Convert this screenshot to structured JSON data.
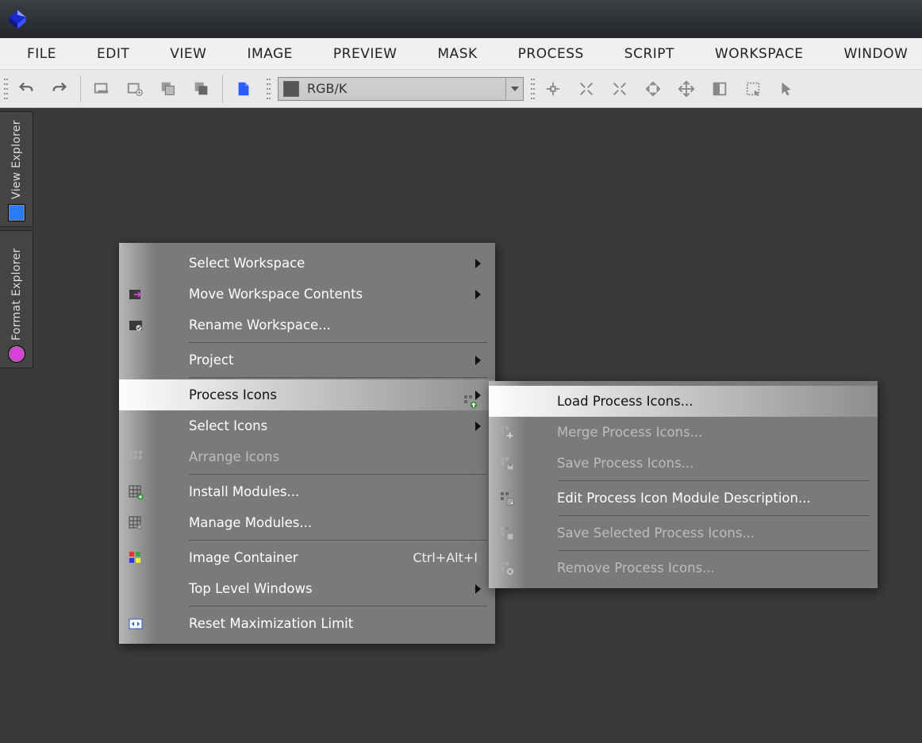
{
  "menubar": {
    "items": [
      "FILE",
      "EDIT",
      "VIEW",
      "IMAGE",
      "PREVIEW",
      "MASK",
      "PROCESS",
      "SCRIPT",
      "WORKSPACE",
      "WINDOW"
    ]
  },
  "toolbar": {
    "color_mode": "RGB/K"
  },
  "side_tabs": {
    "view": "View Explorer",
    "format": "Format Explorer"
  },
  "context_menu": {
    "main": {
      "select_workspace": "Select Workspace",
      "move_workspace_contents": "Move Workspace Contents",
      "rename_workspace": "Rename Workspace...",
      "project": "Project",
      "process_icons": "Process Icons",
      "select_icons": "Select Icons",
      "arrange_icons": "Arrange Icons",
      "install_modules": "Install Modules...",
      "manage_modules": "Manage Modules...",
      "image_container": "Image Container",
      "image_container_shortcut": "Ctrl+Alt+I",
      "top_level_windows": "Top Level Windows",
      "reset_max_limit": "Reset Maximization Limit"
    },
    "sub": {
      "load": "Load Process Icons...",
      "merge": "Merge Process Icons...",
      "save": "Save Process Icons...",
      "edit_desc": "Edit Process Icon Module Description...",
      "save_selected": "Save Selected Process Icons...",
      "remove": "Remove Process Icons..."
    }
  }
}
